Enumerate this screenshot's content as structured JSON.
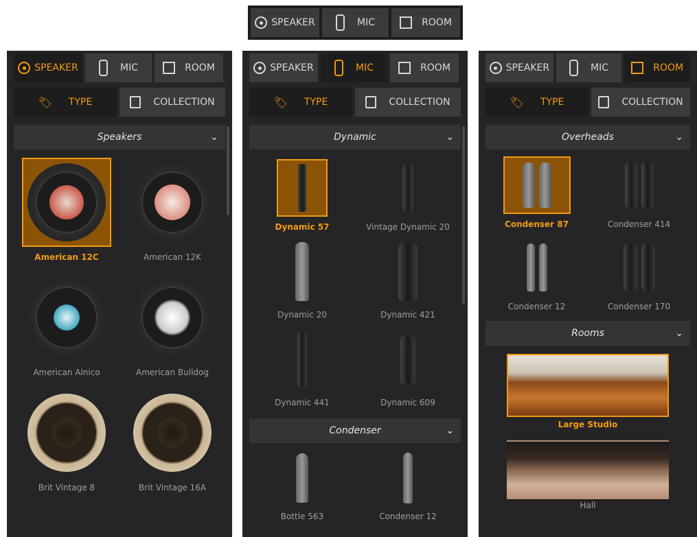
{
  "accent": "#f39a12",
  "top_tabs": [
    "SPEAKER",
    "MIC",
    "ROOM"
  ],
  "sub_tabs": [
    "TYPE",
    "COLLECTION"
  ],
  "panel1": {
    "section": "Speakers",
    "items": [
      "American 12C",
      "American 12K",
      "American Alnico",
      "American Bulldog",
      "Brit Vintage 8",
      "Brit Vintage 16A"
    ]
  },
  "panel2": {
    "section1": "Dynamic",
    "items1": [
      "Dynamic 57",
      "Vintage Dynamic 20",
      "Dynamic 20",
      "Dynamic 421",
      "Dynamic 441",
      "Dynamic 609"
    ],
    "section2": "Condenser",
    "items2": [
      "Bottle 563",
      "Condenser 12"
    ]
  },
  "panel3": {
    "section1": "Overheads",
    "items1": [
      "Condenser 87",
      "Condenser 414",
      "Condenser 12",
      "Condenser 170"
    ],
    "section2": "Rooms",
    "rooms": [
      "Large Studio",
      "Hall"
    ]
  },
  "chevron": "⌄"
}
